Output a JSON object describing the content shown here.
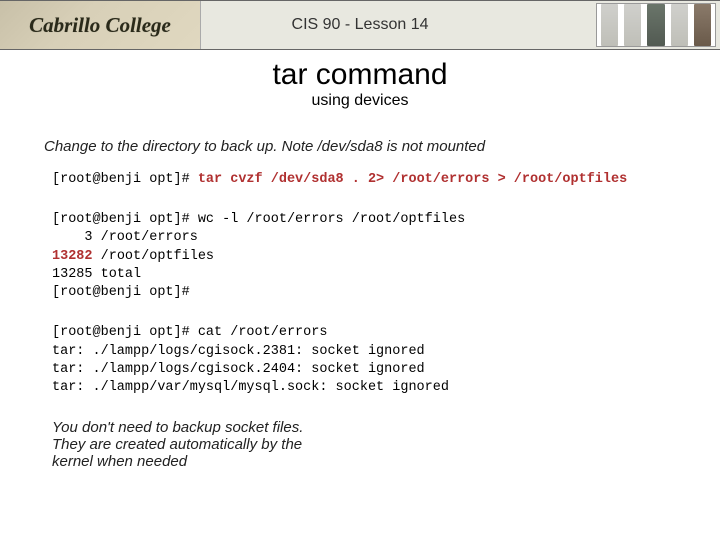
{
  "header": {
    "logo_text": "Cabrillo College",
    "course_title": "CIS 90 - Lesson 14"
  },
  "title": "tar command",
  "subtitle": "using devices",
  "intro_note": "Change to the directory to back up.  Note /dev/sda8 is not mounted",
  "terminal": {
    "block1_prompt": "[root@benji opt]# ",
    "block1_cmd": "tar cvzf /dev/sda8 . 2> /root/errors > /root/optfiles",
    "block2_line1": "[root@benji opt]# wc -l /root/errors /root/optfiles",
    "block2_line2": "    3 /root/errors",
    "block2_hi": "13282",
    "block2_line3_rest": " /root/optfiles",
    "block2_line4": "13285 total",
    "block2_line5": "[root@benji opt]#",
    "block3_line1": "[root@benji opt]# cat /root/errors",
    "block3_line2": "tar: ./lampp/logs/cgisock.2381: socket ignored",
    "block3_line3": "tar: ./lampp/logs/cgisock.2404: socket ignored",
    "block3_line4": "tar: ./lampp/var/mysql/mysql.sock: socket ignored"
  },
  "closing_note_l1": "You don't need to backup socket files.",
  "closing_note_l2": "They are created automatically by the",
  "closing_note_l3": "kernel when needed"
}
